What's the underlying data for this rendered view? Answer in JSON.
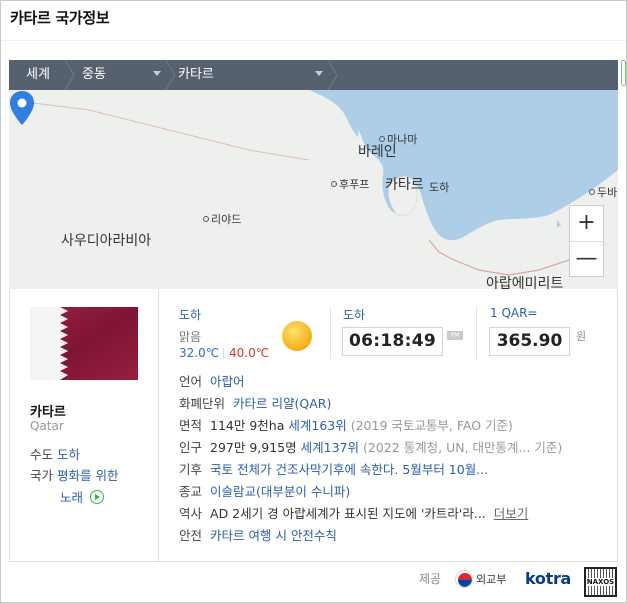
{
  "page": {
    "title": "카타르 국가정보"
  },
  "nav": {
    "items": [
      {
        "label": "세계"
      },
      {
        "label": "중동"
      },
      {
        "label": "카타르"
      }
    ]
  },
  "map": {
    "labels": {
      "manama": "마나마",
      "bahrain": "바레인",
      "qatar": "카타르",
      "doha": "도하",
      "hofuf": "후푸프",
      "riyadh": "리야드",
      "saudi": "사우디아라비아",
      "dubai": "두바",
      "uae": "아랍에미리트"
    },
    "zoom_in": "+",
    "zoom_out": "—",
    "colors": {
      "sea": "#aecde6",
      "land": "#eef0ee",
      "border": "#d9a6a6",
      "pin": "#2f7ee0"
    }
  },
  "country": {
    "name": "카타르",
    "name_en": "Qatar",
    "capital_label": "수도",
    "capital": "도하",
    "anthem_label": "국가",
    "anthem_line1": "평화를 위한",
    "anthem_line2": "노래",
    "flag_colors": {
      "hoist": "#ffffff",
      "field": "#8d1b3d"
    }
  },
  "weather": {
    "city": "도하",
    "condition": "맑음",
    "low": "32.0℃",
    "high": "40.0℃",
    "icon": "sun-icon"
  },
  "time": {
    "city": "도하",
    "value": "06:18:49",
    "ampm": "PM"
  },
  "currency": {
    "head": "1 QAR=",
    "value": "365.90",
    "unit": "원"
  },
  "facts": {
    "language": {
      "key": "언어",
      "value": "아랍어"
    },
    "currency": {
      "key": "화폐단위",
      "value": "카타르 리얄(QAR)"
    },
    "area": {
      "key": "면적",
      "value": "114만 9천ha",
      "rank": "세계163위",
      "source": "(2019 국토교통부, FAO 기준)"
    },
    "population": {
      "key": "인구",
      "value": "297만 9,915명",
      "rank": "세계137위",
      "source": "(2022 통계청, UN, 대만통계... 기준)"
    },
    "climate": {
      "key": "기후",
      "value": "국토 전체가 건조사막기후에 속한다. 5월부터 10월..."
    },
    "religion": {
      "key": "종교",
      "value": "이슬람교(대부분이 수니파)"
    },
    "history": {
      "key": "역사",
      "value": "AD 2세기 경 아랍세계가 표시된 지도에 '카트라'라...",
      "more": "더보기"
    },
    "safety": {
      "key": "안전",
      "value": "카타르 여행 시 안전수칙"
    }
  },
  "footer": {
    "provided_by": "제공",
    "mofa": "외교부",
    "kotra": "kotra",
    "naxos": "NAXOS"
  }
}
